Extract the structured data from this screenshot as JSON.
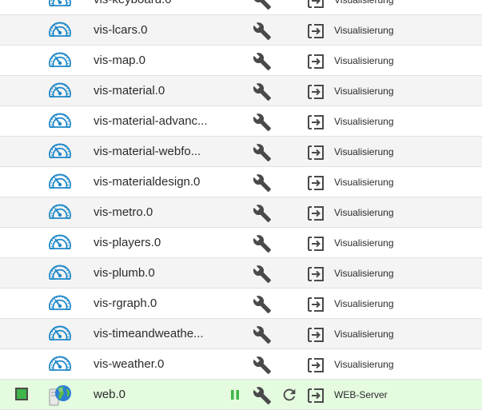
{
  "adapters": [
    {
      "name": "vis-keyboard.0",
      "category": "Visualisierung",
      "icon": "gauge-icon",
      "status": null,
      "pausable": false,
      "reloadable": false
    },
    {
      "name": "vis-lcars.0",
      "category": "Visualisierung",
      "icon": "gauge-icon",
      "status": null,
      "pausable": false,
      "reloadable": false
    },
    {
      "name": "vis-map.0",
      "category": "Visualisierung",
      "icon": "gauge-icon",
      "status": null,
      "pausable": false,
      "reloadable": false
    },
    {
      "name": "vis-material.0",
      "category": "Visualisierung",
      "icon": "gauge-icon",
      "status": null,
      "pausable": false,
      "reloadable": false
    },
    {
      "name": "vis-material-advanc...",
      "category": "Visualisierung",
      "icon": "gauge-icon",
      "status": null,
      "pausable": false,
      "reloadable": false
    },
    {
      "name": "vis-material-webfo...",
      "category": "Visualisierung",
      "icon": "gauge-icon",
      "status": null,
      "pausable": false,
      "reloadable": false
    },
    {
      "name": "vis-materialdesign.0",
      "category": "Visualisierung",
      "icon": "gauge-icon",
      "status": null,
      "pausable": false,
      "reloadable": false
    },
    {
      "name": "vis-metro.0",
      "category": "Visualisierung",
      "icon": "gauge-icon",
      "status": null,
      "pausable": false,
      "reloadable": false
    },
    {
      "name": "vis-players.0",
      "category": "Visualisierung",
      "icon": "gauge-icon",
      "status": null,
      "pausable": false,
      "reloadable": false
    },
    {
      "name": "vis-plumb.0",
      "category": "Visualisierung",
      "icon": "gauge-icon",
      "status": null,
      "pausable": false,
      "reloadable": false
    },
    {
      "name": "vis-rgraph.0",
      "category": "Visualisierung",
      "icon": "gauge-icon",
      "status": null,
      "pausable": false,
      "reloadable": false
    },
    {
      "name": "vis-timeandweathe...",
      "category": "Visualisierung",
      "icon": "gauge-icon",
      "status": null,
      "pausable": false,
      "reloadable": false
    },
    {
      "name": "vis-weather.0",
      "category": "Visualisierung",
      "icon": "gauge-icon",
      "status": null,
      "pausable": false,
      "reloadable": false
    },
    {
      "name": "web.0",
      "category": "WEB-Server",
      "icon": "globe-server-icon",
      "status": "running",
      "pausable": true,
      "reloadable": true
    }
  ],
  "colors": {
    "gauge_icon": "#1e88c8",
    "action_icon": "#4a4a4a",
    "pause_icon": "#3fb54a",
    "status_running": "#3fb54a",
    "active_row_bg": "#e4fbe0",
    "odd_row_bg": "#f4f4f4"
  }
}
